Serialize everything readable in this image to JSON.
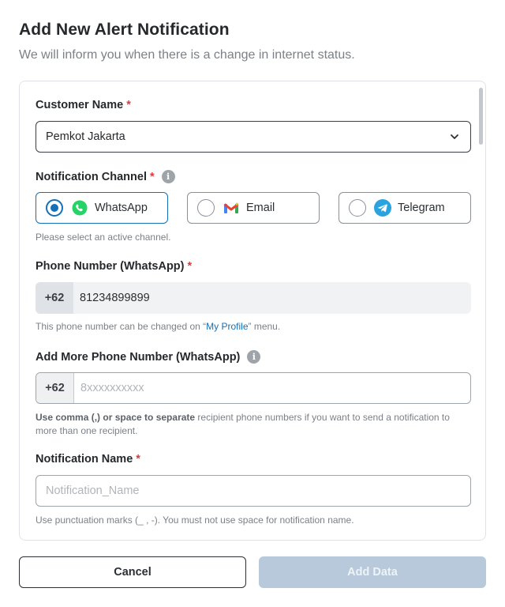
{
  "header": {
    "title": "Add New Alert Notification",
    "subtitle": "We will inform you when there is a change in internet status."
  },
  "form": {
    "customer_name": {
      "label": "Customer Name",
      "required_mark": "*",
      "value": "Pemkot Jakarta"
    },
    "notification_channel": {
      "label": "Notification Channel",
      "required_mark": "*",
      "info": "i",
      "options": [
        {
          "label": "WhatsApp",
          "icon": "whatsapp-icon",
          "selected": true
        },
        {
          "label": "Email",
          "icon": "gmail-icon",
          "selected": false
        },
        {
          "label": "Telegram",
          "icon": "telegram-icon",
          "selected": false
        }
      ],
      "hint": "Please select an active channel."
    },
    "phone_number": {
      "label": "Phone Number (WhatsApp)",
      "required_mark": "*",
      "prefix": "+62",
      "value": "81234899899",
      "hint_before": "This phone number can be changed on “",
      "hint_link": "My Profile",
      "hint_after": "” menu."
    },
    "more_phone": {
      "label": "Add More Phone Number (WhatsApp)",
      "info": "i",
      "prefix": "+62",
      "placeholder": "8xxxxxxxxxx",
      "hint_bold": "Use comma (,) or space to separate",
      "hint_rest": " recipient phone numbers if you want to send a notification to more than one recipient."
    },
    "notification_name": {
      "label": "Notification Name",
      "required_mark": "*",
      "placeholder": "Notification_Name",
      "hint": "Use punctuation marks (_ , -). You must not use space for notification name."
    }
  },
  "buttons": {
    "cancel": "Cancel",
    "add": "Add Data"
  },
  "colors": {
    "accent": "#1470b8",
    "required": "#e0383e",
    "disabled_button": "#b7c9da",
    "whatsapp": "#25d366",
    "telegram": "#2aa3df"
  }
}
